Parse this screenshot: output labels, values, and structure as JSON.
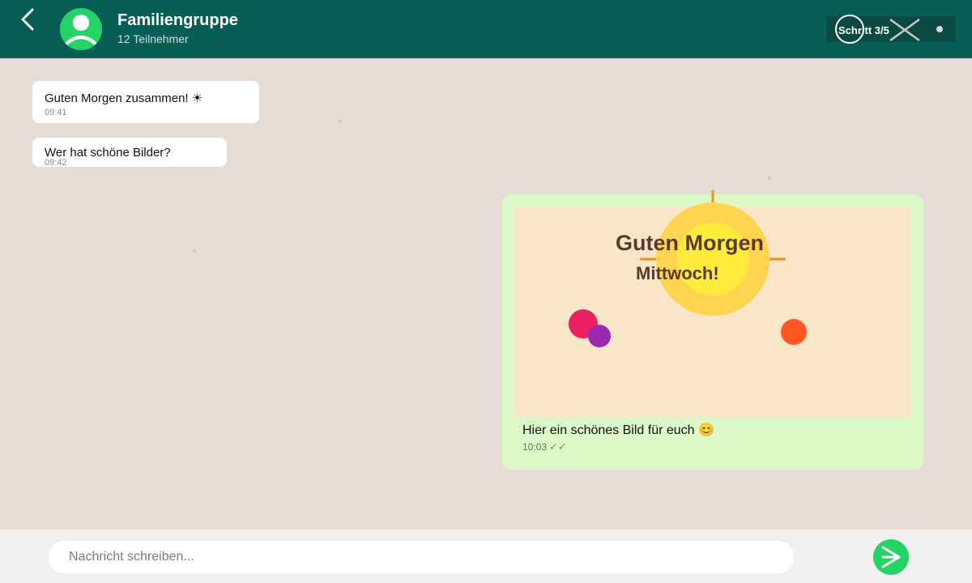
{
  "header": {
    "group_name": "Familiengruppe",
    "participants": "12 Teilnehmer",
    "step": "Schritt 3/5",
    "icons": {
      "back": "chevron-left-icon",
      "avatar": "user-icon",
      "close": "close-icon",
      "menu": "dot-icon"
    }
  },
  "messages": [
    {
      "text": "Guten Morgen zusammen! ☀",
      "time": "09:41"
    },
    {
      "text": "Wer hat schöne Bilder?",
      "time": "09:42"
    }
  ],
  "outgoing": {
    "image": {
      "title": "Guten Morgen",
      "subtitle": "Mittwoch!",
      "icons": [
        "sun-icon",
        "flower-icon",
        "flower-icon",
        "flower-icon"
      ]
    },
    "caption": "Hier ein schönes Bild für euch 😊",
    "time": "10:03",
    "ticks": "✓✓"
  },
  "composer": {
    "placeholder": "Nachricht schreiben...",
    "send_icon": "send-icon"
  },
  "colors": {
    "header": "#075e54",
    "accent": "#25d366",
    "chat_background": "#e5ddd5",
    "outgoing_bubble": "#dcf8c6",
    "incoming_bubble": "#ffffff"
  }
}
